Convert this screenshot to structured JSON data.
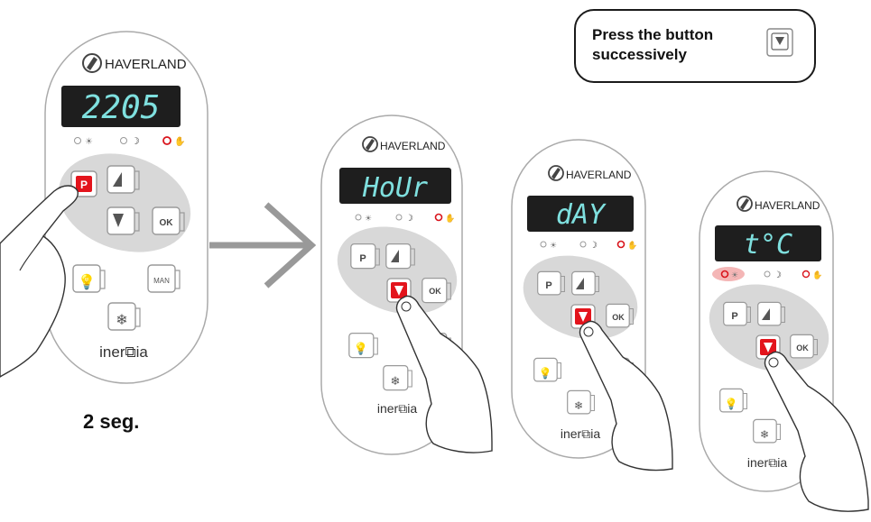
{
  "instruction": {
    "line1": "Press the button",
    "line2": "successively",
    "icon": "down-arrow-button-icon"
  },
  "duration_label": "2 seg.",
  "devices": [
    {
      "brand": "HAVERLAND",
      "display": "2205",
      "footer_brand": "iner⧉ia",
      "pressed": "P",
      "lit_indicator": "manual"
    },
    {
      "brand": "HAVERLAND",
      "display": "HoUr",
      "footer_brand": "iner⧉ia",
      "pressed": "down",
      "lit_indicator": "manual"
    },
    {
      "brand": "HAVERLAND",
      "display": "dAY",
      "footer_brand": "iner⧉ia",
      "pressed": "down",
      "lit_indicator": "manual"
    },
    {
      "brand": "HAVERLAND",
      "display": "t°C",
      "footer_brand": "iner⧉ia",
      "pressed": "down",
      "lit_indicator": "comfort"
    }
  ],
  "button_labels": {
    "p": "P",
    "ok": "OK",
    "man": "MAN"
  },
  "colors": {
    "display_bg": "#1e1e1e",
    "segment": "#7fe0df",
    "pressed": "#e3141c",
    "highlight": "#d8d8d8",
    "indicator_red": "#d9141c"
  }
}
